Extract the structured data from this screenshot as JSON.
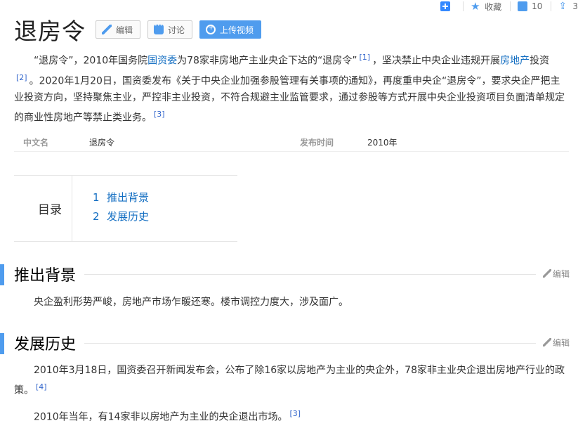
{
  "topbar": {
    "collect_label": "收藏",
    "like_count": "10",
    "share_count": "3"
  },
  "title": "退房令",
  "buttons": {
    "edit": "编辑",
    "discuss": "讨论",
    "upload": "上传视频"
  },
  "intro": {
    "p1_a": "“退房令”，2010年国务院",
    "p1_link": "国资委",
    "p1_b": "为78家非房地产主业央企下达的“退房令”",
    "ref1": "[1]",
    "p1_c": "，坚决禁止中央企业违规开展",
    "p1_link2": "房地产",
    "p1_d": "投资",
    "ref2": "[2]",
    "p1_e": "。2020年1月20日，国资委发布《关于中央企业加强参股管理有关事项的通知》，再度重申央企“退房令”，要求央企严把主业投资方向，坚持聚焦主业，严控非主业投资，不符合规避主业监管要求，通过参股等方式开展中央企业投资项目负面清单规定的商业性房地产等禁止类业务。",
    "ref3": "[3]"
  },
  "info": {
    "k1": "中文名",
    "v1": "退房令",
    "k2": "发布时间",
    "v2": "2010年"
  },
  "toc": {
    "label": "目录",
    "items": [
      {
        "num": "1",
        "text": "推出背景"
      },
      {
        "num": "2",
        "text": "发展历史"
      }
    ]
  },
  "sections": {
    "s1": {
      "title": "推出背景",
      "edit": "编辑",
      "text": "央企盈利形势严峻，房地产市场乍暖还寒。楼市调控力度大，涉及面广。"
    },
    "s2": {
      "title": "发展历史",
      "edit": "编辑",
      "p1": "2010年3月18日，国资委召开新闻发布会，公布了除16家以房地产为主业的央企外，78家非主业央企退出房地产行业的政策。",
      "ref4": "[4]",
      "p2": "2010年当年，有14家非以房地产为主业的央企退出市场。",
      "ref3": "[3]"
    }
  }
}
